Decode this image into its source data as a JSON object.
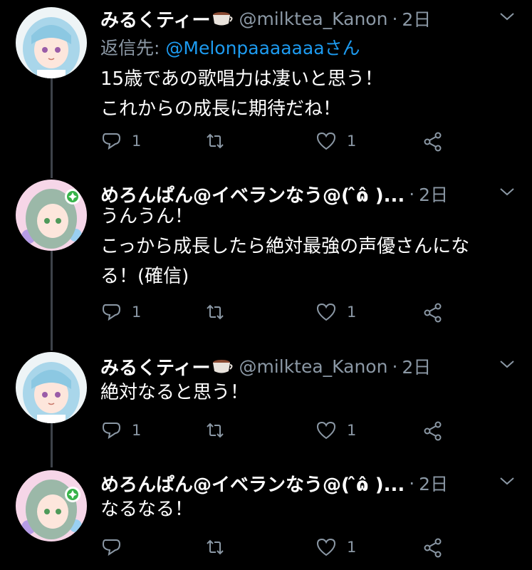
{
  "tweets": [
    {
      "author": {
        "name": "みるくティー",
        "badge_icon": "coffee-cup-emoji",
        "handle": "@milktea_Kanon"
      },
      "time": "2日",
      "reply_to": {
        "prefix": "返信先: ",
        "user": "@Melonpaaaaaaaさん"
      },
      "lines": [
        "15歳であの歌唱力は凄いと思う！",
        "これからの成長に期待だね！"
      ],
      "counts": {
        "reply": "1",
        "retweet": "",
        "like": "1"
      }
    },
    {
      "author": {
        "name": "めろんぱん@イベランなう@(  ̂ɷ̂ )...",
        "handle": ""
      },
      "time": "2日",
      "lines": [
        "うんうん！",
        "こっから成長したら絶対最強の声優さんにな",
        "る！(確信)"
      ],
      "counts": {
        "reply": "1",
        "retweet": "",
        "like": "1"
      }
    },
    {
      "author": {
        "name": "みるくティー",
        "badge_icon": "coffee-cup-emoji",
        "handle": "@milktea_Kanon"
      },
      "time": "2日",
      "lines": [
        "絶対なると思う！"
      ],
      "counts": {
        "reply": "1",
        "retweet": "",
        "like": "1"
      }
    },
    {
      "author": {
        "name": "めろんぱん@イベランなう@(  ̂ɷ̂ )...",
        "handle": ""
      },
      "time": "2日",
      "lines": [
        "なるなる！"
      ],
      "counts": {
        "reply": "",
        "retweet": "",
        "like": "1"
      }
    }
  ],
  "colors": {
    "background": "#000000",
    "secondary_text": "#8b98a5",
    "link": "#1d9bf0",
    "thread_line": "#3d4249"
  }
}
